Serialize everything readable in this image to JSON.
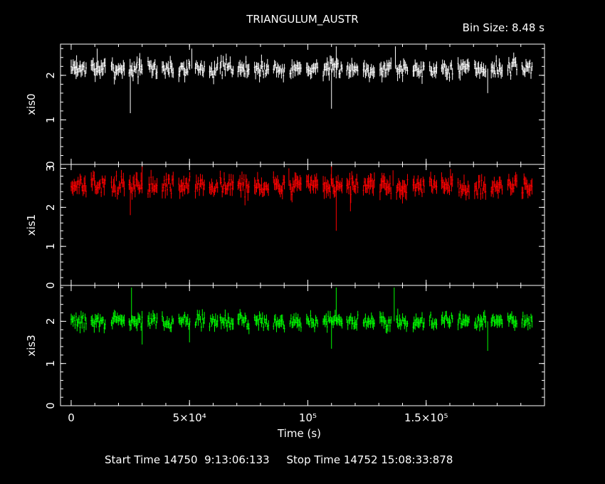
{
  "title": "TRIANGULUM_AUSTR",
  "bin_size_label": "Bin Size: 8.48 s",
  "footer": {
    "start_time": "Start Time 14750  9:13:06:133",
    "stop_time": "Stop Time 14752 15:08:33:878"
  },
  "chart_data": {
    "type": "line",
    "title": "TRIANGULUM_AUSTR",
    "xlabel": "Time (s)",
    "xlim": [
      -4500,
      200000
    ],
    "x_ticks": [
      {
        "value": 0,
        "label": "0"
      },
      {
        "value": 50000,
        "label": "5×10⁴"
      },
      {
        "value": 100000,
        "label": "10⁵"
      },
      {
        "value": 150000,
        "label": "1.5×10⁵"
      }
    ],
    "panels": [
      {
        "name": "xis0",
        "ylabel": "xis0",
        "color": "#ffffff",
        "ylim": [
          0,
          2.7
        ],
        "y_ticks": [
          0,
          1,
          2
        ],
        "mean": 2.15,
        "noise": 0.13,
        "seed": 7,
        "spikes": [
          {
            "t": 2300,
            "v": 2.45
          },
          {
            "t": 11000,
            "v": 2.6
          },
          {
            "t": 25000,
            "v": 1.15
          },
          {
            "t": 29000,
            "v": 2.5
          },
          {
            "t": 51000,
            "v": 2.6
          },
          {
            "t": 110000,
            "v": 1.25
          },
          {
            "t": 112000,
            "v": 2.65
          },
          {
            "t": 137000,
            "v": 2.65
          },
          {
            "t": 176000,
            "v": 1.6
          }
        ]
      },
      {
        "name": "xis1",
        "ylabel": "xis1",
        "color": "#ff0000",
        "ylim": [
          0,
          3.1
        ],
        "y_ticks": [
          0,
          1,
          2,
          3
        ],
        "mean": 2.55,
        "noise": 0.17,
        "seed": 13,
        "spikes": [
          {
            "t": 25000,
            "v": 1.8
          },
          {
            "t": 30000,
            "v": 3.05
          },
          {
            "t": 92000,
            "v": 3.0
          },
          {
            "t": 110000,
            "v": 3.05
          },
          {
            "t": 112000,
            "v": 1.4
          },
          {
            "t": 118000,
            "v": 1.9
          },
          {
            "t": 136000,
            "v": 2.95
          },
          {
            "t": 140000,
            "v": 2.1
          }
        ]
      },
      {
        "name": "xis3",
        "ylabel": "xis3",
        "color": "#00ff00",
        "ylim": [
          0,
          2.85
        ],
        "y_ticks": [
          0,
          1,
          2
        ],
        "mean": 2.0,
        "noise": 0.12,
        "seed": 29,
        "spikes": [
          {
            "t": 25500,
            "v": 2.8
          },
          {
            "t": 30000,
            "v": 1.45
          },
          {
            "t": 50000,
            "v": 1.5
          },
          {
            "t": 110000,
            "v": 1.35
          },
          {
            "t": 112000,
            "v": 2.8
          },
          {
            "t": 136500,
            "v": 2.8
          },
          {
            "t": 138000,
            "v": 2.3
          },
          {
            "t": 176000,
            "v": 1.3
          }
        ]
      }
    ],
    "segments": [
      [
        0,
        6500
      ],
      [
        8500,
        14500
      ],
      [
        17000,
        22500
      ],
      [
        24500,
        30000
      ],
      [
        32500,
        36500
      ],
      [
        38500,
        43500
      ],
      [
        45500,
        50500
      ],
      [
        52500,
        56500
      ],
      [
        58500,
        62000
      ],
      [
        63000,
        68500
      ],
      [
        70500,
        75500
      ],
      [
        77500,
        83500
      ],
      [
        85500,
        90500
      ],
      [
        92500,
        97500
      ],
      [
        99500,
        104500
      ],
      [
        106500,
        114500
      ],
      [
        116500,
        121500
      ],
      [
        123500,
        128500
      ],
      [
        130500,
        135500
      ],
      [
        137500,
        142500
      ],
      [
        144500,
        149500
      ],
      [
        151500,
        154500
      ],
      [
        156500,
        161500
      ],
      [
        163500,
        168500
      ],
      [
        170500,
        175500
      ],
      [
        177500,
        182500
      ],
      [
        184500,
        188500
      ],
      [
        190500,
        195000
      ]
    ]
  }
}
